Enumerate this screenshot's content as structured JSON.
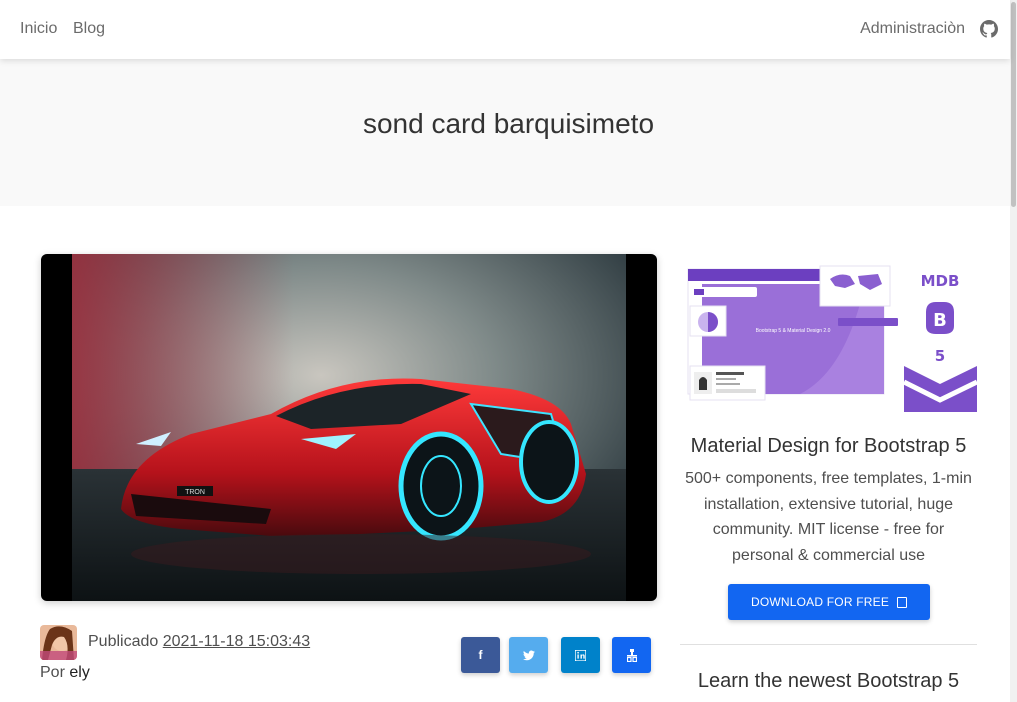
{
  "nav": {
    "inicio": "Inicio",
    "blog": "Blog",
    "admin": "Administraciòn",
    "github_icon": "github-icon"
  },
  "hero": {
    "title": "sond card barquisimeto"
  },
  "post": {
    "image_alt": "car-image",
    "published_label": "Publicado",
    "published_date": "2021-11-18 15:03:43",
    "author_label": "Por",
    "author_name": "ely",
    "image_text": "TRON",
    "share": {
      "facebook": "f",
      "twitter": "twitter-icon",
      "linkedin": "in",
      "other": "share-icon"
    }
  },
  "sidebar": {
    "ad_brand": "MDB",
    "ad_logo_letter": "B",
    "ad_version": "5",
    "ad_mock_text": "Bootstrap 5 & Material Design 2.0",
    "ad_title": "Material Design for Bootstrap 5",
    "ad_description": "500+ components, free templates, 1-min installation, extensive tutorial, huge community. MIT license - free for personal & commercial use",
    "ad_button": "DOWNLOAD FOR FREE",
    "learn_title": "Learn the newest Bootstrap 5"
  },
  "colors": {
    "primary": "#1266f1",
    "facebook": "#3b5998",
    "twitter": "#55acee",
    "linkedin": "#0082ca",
    "mdb_purple": "#7b4fc9"
  }
}
